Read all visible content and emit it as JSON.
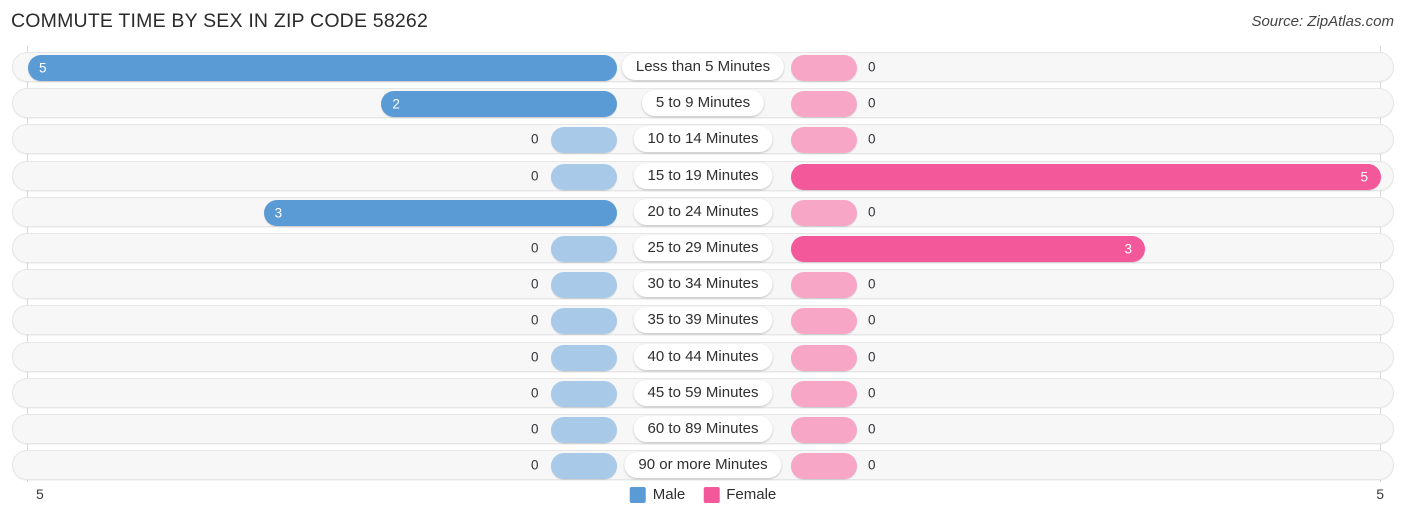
{
  "header": {
    "title": "COMMUTE TIME BY SEX IN ZIP CODE 58262",
    "source": "Source: ZipAtlas.com"
  },
  "legend": {
    "male_label": "Male",
    "female_label": "Female",
    "male_color": "#5b9bd5",
    "female_color": "#f2589a"
  },
  "axis": {
    "left_tick": "5",
    "right_tick": "5"
  },
  "chart_data": {
    "type": "bar",
    "orientation": "horizontal-diverging",
    "title": "COMMUTE TIME BY SEX IN ZIP CODE 58262",
    "xlabel": "",
    "ylabel": "",
    "xlim": [
      0,
      5
    ],
    "grid": false,
    "legend_position": "bottom-center",
    "categories": [
      "Less than 5 Minutes",
      "5 to 9 Minutes",
      "10 to 14 Minutes",
      "15 to 19 Minutes",
      "20 to 24 Minutes",
      "25 to 29 Minutes",
      "30 to 34 Minutes",
      "35 to 39 Minutes",
      "40 to 44 Minutes",
      "45 to 59 Minutes",
      "60 to 89 Minutes",
      "90 or more Minutes"
    ],
    "series": [
      {
        "name": "Male",
        "color": "#5b9bd5",
        "values": [
          5,
          2,
          0,
          0,
          3,
          0,
          0,
          0,
          0,
          0,
          0,
          0
        ],
        "labels": [
          "5",
          "2",
          "0",
          "0",
          "3",
          "0",
          "0",
          "0",
          "0",
          "0",
          "0",
          "0"
        ]
      },
      {
        "name": "Female",
        "color": "#f2589a",
        "values": [
          0,
          0,
          0,
          5,
          0,
          3,
          0,
          0,
          0,
          0,
          0,
          0
        ],
        "labels": [
          "0",
          "0",
          "0",
          "5",
          "0",
          "3",
          "0",
          "0",
          "0",
          "0",
          "0",
          "0"
        ]
      }
    ]
  }
}
